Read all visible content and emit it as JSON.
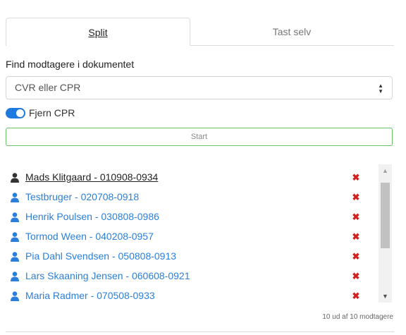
{
  "tabs": {
    "split_label": "Split",
    "tast_label": "Tast selv"
  },
  "find": {
    "label": "Find modtagere i dokumentet",
    "select_value": "CVR eller CPR"
  },
  "toggle": {
    "label": "Fjern CPR",
    "on": true
  },
  "start_button_label": "Start",
  "recipients": [
    {
      "name": "Mads Klitgaard - 010908-0934"
    },
    {
      "name": "Testbruger - 020708-0918"
    },
    {
      "name": "Henrik Poulsen - 030808-0986"
    },
    {
      "name": "Tormod Ween - 040208-0957"
    },
    {
      "name": "Pia Dahl Svendsen - 050808-0913"
    },
    {
      "name": "Lars Skaaning Jensen - 060608-0921"
    },
    {
      "name": "Maria Radmer - 070508-0933"
    }
  ],
  "count_text": "10 ud af 10 modtagere",
  "colors": {
    "link": "#2b7fd9",
    "delete": "#d02020",
    "toggle": "#1f7ae0",
    "start_border": "#6abf69"
  },
  "icons": {
    "person": "person-icon",
    "delete": "delete-x-icon",
    "caret": "sort-caret-icon"
  }
}
